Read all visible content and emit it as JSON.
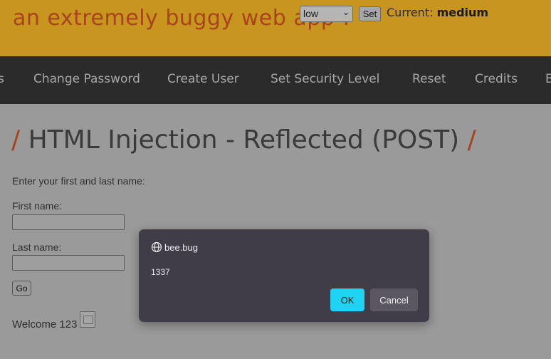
{
  "header": {
    "tagline": "an extremely buggy web app !",
    "security_select": {
      "selected": "low",
      "caret": "⌄"
    },
    "set_label": "Set",
    "current_label": "Current: ",
    "current_value": "medium"
  },
  "nav": {
    "items": [
      {
        "label": "s"
      },
      {
        "label": "Change Password"
      },
      {
        "label": "Create User"
      },
      {
        "label": "Set Security Level"
      },
      {
        "label": "Reset"
      },
      {
        "label": "Credits"
      },
      {
        "label": "B"
      }
    ]
  },
  "main": {
    "title_slash_left": "/",
    "title": "HTML Injection - Reflected (POST)",
    "title_slash_right": "/",
    "intro": "Enter your first and last name:",
    "first_name_label": "First name:",
    "last_name_label": "Last name:",
    "first_name_value": "",
    "last_name_value": "",
    "go_label": "Go",
    "welcome_text": "Welcome 123"
  },
  "dialog": {
    "origin": "bee.bug",
    "message": "1337",
    "ok_label": "OK",
    "cancel_label": "Cancel",
    "ok_color": "#1fd3f2",
    "icon": "globe-icon"
  },
  "colors": {
    "header_bg": "#c8961e",
    "accent": "#a8431e",
    "nav_bg": "#2b2b2b"
  }
}
